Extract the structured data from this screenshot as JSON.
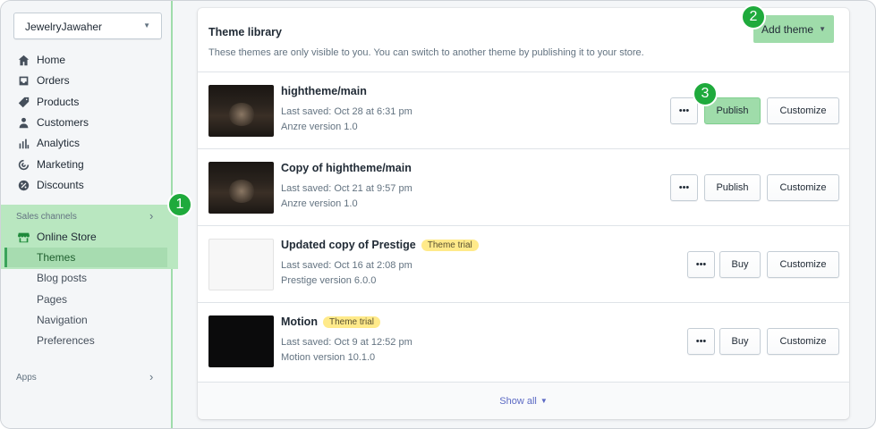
{
  "sidebar": {
    "store_name": "JewelryJawaher",
    "nav": [
      {
        "label": "Home",
        "icon": "home-icon"
      },
      {
        "label": "Orders",
        "icon": "orders-icon"
      },
      {
        "label": "Products",
        "icon": "tag-icon"
      },
      {
        "label": "Customers",
        "icon": "person-icon"
      },
      {
        "label": "Analytics",
        "icon": "bar-chart-icon"
      },
      {
        "label": "Marketing",
        "icon": "target-icon"
      },
      {
        "label": "Discounts",
        "icon": "discount-icon"
      }
    ],
    "sales_channels_label": "Sales channels",
    "online_store_label": "Online Store",
    "sub_items": [
      "Themes",
      "Blog posts",
      "Pages",
      "Navigation",
      "Preferences"
    ],
    "apps_label": "Apps"
  },
  "theme_library": {
    "title": "Theme library",
    "subtitle": "These themes are only visible to you. You can switch to another theme by publishing it to your store.",
    "add_theme_label": "Add theme",
    "show_all_label": "Show all",
    "themes": [
      {
        "name": "hightheme/main",
        "trial": "",
        "saved": "Last saved: Oct 28 at 6:31 pm",
        "version": "Anzre version 1.0",
        "action": "Publish",
        "customize": "Customize",
        "more": "•••"
      },
      {
        "name": "Copy of hightheme/main",
        "trial": "",
        "saved": "Last saved: Oct 21 at 9:57 pm",
        "version": "Anzre version 1.0",
        "action": "Publish",
        "customize": "Customize",
        "more": "•••"
      },
      {
        "name": "Updated copy of Prestige",
        "trial": "Theme trial",
        "saved": "Last saved: Oct 16 at 2:08 pm",
        "version": "Prestige version 6.0.0",
        "action": "Buy",
        "customize": "Customize",
        "more": "•••"
      },
      {
        "name": "Motion",
        "trial": "Theme trial",
        "saved": "Last saved: Oct 9 at 12:52 pm",
        "version": "Motion version 10.1.0",
        "action": "Buy",
        "customize": "Customize",
        "more": "•••"
      }
    ]
  },
  "step_badges": [
    "1",
    "2",
    "3"
  ],
  "colors": {
    "highlight": "#9fdcaa",
    "badge": "#1faa3c",
    "link": "#5c6ac4",
    "trial": "#ffea8a"
  }
}
